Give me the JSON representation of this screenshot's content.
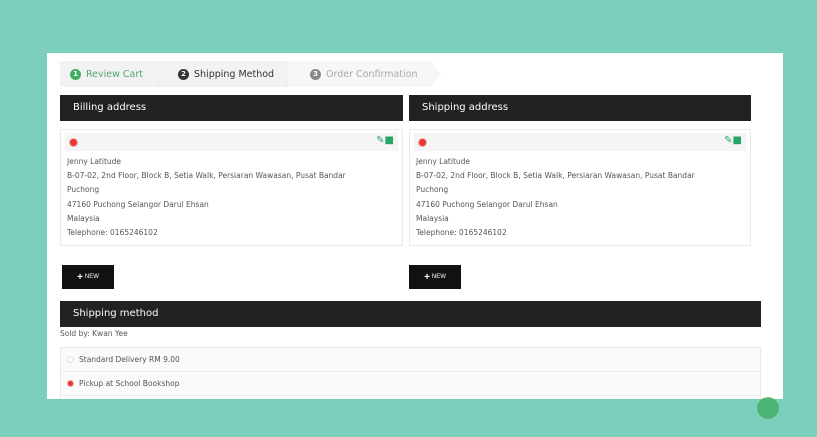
{
  "steps": [
    {
      "num": "1",
      "label": "Review Cart"
    },
    {
      "num": "2",
      "label": "Shipping Method"
    },
    {
      "num": "3",
      "label": "Order Confirmation"
    }
  ],
  "billing": {
    "title": "Billing address",
    "name": "Jenny Latitude",
    "line1": "B-07-02, 2nd Floor, Block B, Setia Walk, Persiaran Wawasan, Pusat Bandar",
    "line2": "Puchong",
    "line3": "47160 Puchong Selangor Darul Ehsan",
    "country": "Malaysia",
    "phone": "Telephone: 0165246102",
    "new_label": "NEW"
  },
  "shipping": {
    "title": "Shipping address",
    "name": "Jenny Latitude",
    "line1": "B-07-02, 2nd Floor, Block B, Setia Walk, Persiaran Wawasan, Pusat Bandar",
    "line2": "Puchong",
    "line3": "47160 Puchong Selangor Darul Ehsan",
    "country": "Malaysia",
    "phone": "Telephone: 0165246102",
    "new_label": "NEW"
  },
  "method": {
    "title": "Shipping method",
    "sold_by": "Sold by: Kwan Yee",
    "options": [
      {
        "label": "Standard Delivery RM 9.00",
        "selected": false
      },
      {
        "label": "Pickup at School Bookshop",
        "selected": true
      }
    ]
  },
  "colors": {
    "background": "#7ccfba",
    "header": "#222222",
    "accent": "#27a567",
    "selected": "#e53935"
  }
}
